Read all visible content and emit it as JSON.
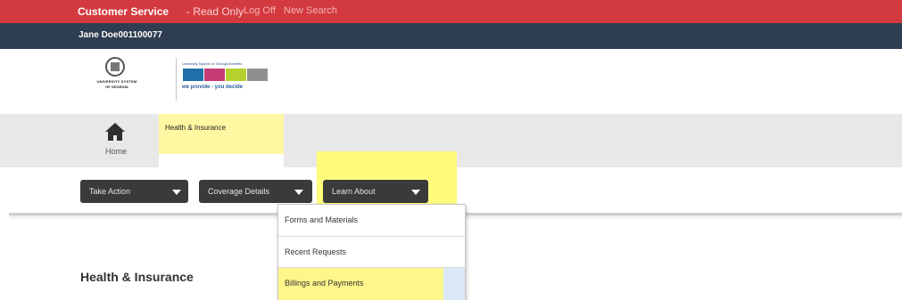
{
  "header": {
    "app_title": "Customer Service",
    "mode": "- Read Only",
    "log_off": "Log Off",
    "new_search": "New Search",
    "user": "Jane Doe001100077",
    "bg_color": "#d33a3f",
    "userbar_color": "#2e3d4f"
  },
  "logos": {
    "usg_line1": "UNIVERSITY SYSTEM",
    "usg_line2": "OF GEORGIA",
    "benefits_small": "University System of Georgia Benefits",
    "benefits_tagline": "we provide - you decide"
  },
  "nav": {
    "home_label": "Home",
    "active_tab": "Health & Insurance"
  },
  "actions": {
    "take_action": "Take Action",
    "coverage_details": "Coverage Details",
    "learn_about": "Learn About"
  },
  "dropdown": {
    "items": [
      "Forms and Materials",
      "Recent Requests",
      "Billings and Payments"
    ]
  },
  "page": {
    "heading": "Health & Insurance"
  }
}
